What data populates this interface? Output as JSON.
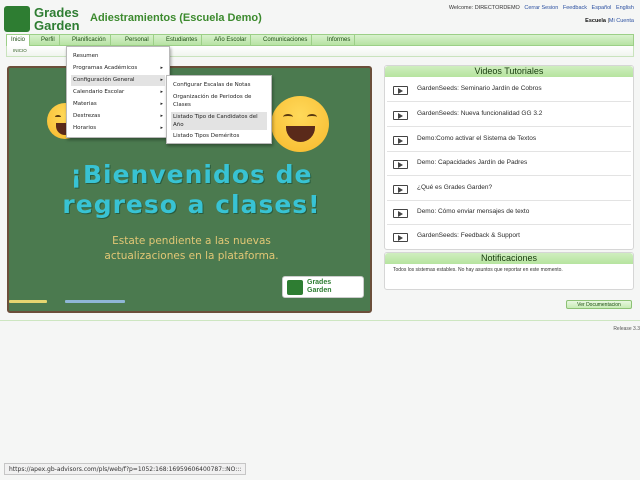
{
  "header": {
    "logo_line1": "Grades",
    "logo_line2": "Garden",
    "app_title": "Adiestramientos (Escuela Demo)",
    "welcome": "Welcome: DIRECTORDEMO",
    "links": [
      "Cerrar Sesion",
      "Feedback",
      "Español",
      "English"
    ],
    "school_label": "Escuela",
    "school_sep": "|",
    "my_account": "Mi Cuenta"
  },
  "nav": {
    "tabs": [
      "Inicio",
      "Perfil",
      "Planificación",
      "Personal",
      "Estudiantes",
      "Año Escolar",
      "Comunicaciones",
      "Informes"
    ],
    "active": "Inicio",
    "breadcrumb": "INICIO"
  },
  "planificacion_menu": {
    "items": [
      {
        "label": "Resumen",
        "has_sub": false
      },
      {
        "label": "Programas Académicos",
        "has_sub": true
      },
      {
        "label": "Configuración General",
        "has_sub": true
      },
      {
        "label": "Calendario Escolar",
        "has_sub": true
      },
      {
        "label": "Materias",
        "has_sub": true
      },
      {
        "label": "Destrezas",
        "has_sub": true
      },
      {
        "label": "Horarios",
        "has_sub": true
      }
    ],
    "highlighted": "Configuración General",
    "arrow": "▸"
  },
  "config_submenu": {
    "items": [
      "Configurar Escalas de Notas",
      "Organización de Periodos de Clases",
      "Listado Tipo de Candidatos del Año",
      "Listado Tipos Deméritos"
    ],
    "highlighted": "Listado Tipo de Candidatos del Año"
  },
  "hero": {
    "headline_line1": "¡Bienvenidos de",
    "headline_line2": "regreso a clases!",
    "sub_line1": "Estate pendiente a las nuevas",
    "sub_line2": "actualizaciones en la plataforma.",
    "logo_line1": "Grades",
    "logo_line2": "Garden",
    "board_color": "#4b7a4f",
    "headline_color": "#38c3d4",
    "sub_color": "#e2c775"
  },
  "videos": {
    "title": "Videos Tutoriales",
    "items": [
      "GardenSeeds: Seminario Jardín de Cobros",
      "GardenSeeds: Nueva funcionalidad GG 3.2",
      "Demo:Como activar el Sistema de Textos",
      "Demo: Capacidades Jardín de Padres",
      "¿Qué es Grades Garden?",
      "Demo: Cómo enviar mensajes de texto",
      "GardenSeeds: Feedback & Support"
    ]
  },
  "notifications": {
    "title": "Notificaciones",
    "text": "Todos los sistemas estables. No hay asuntos que reportar en este momento."
  },
  "doc_button": "Ver Documentacion",
  "release": "Release 3.3",
  "status_url": "https://apex.gb-advisors.com/pls/web/f?p=1052:168:16959606400787::NO:::",
  "colors": {
    "brand_green": "#2e7d32",
    "nav_green": "#b7e3a3",
    "link_blue": "#2a4fa0"
  }
}
